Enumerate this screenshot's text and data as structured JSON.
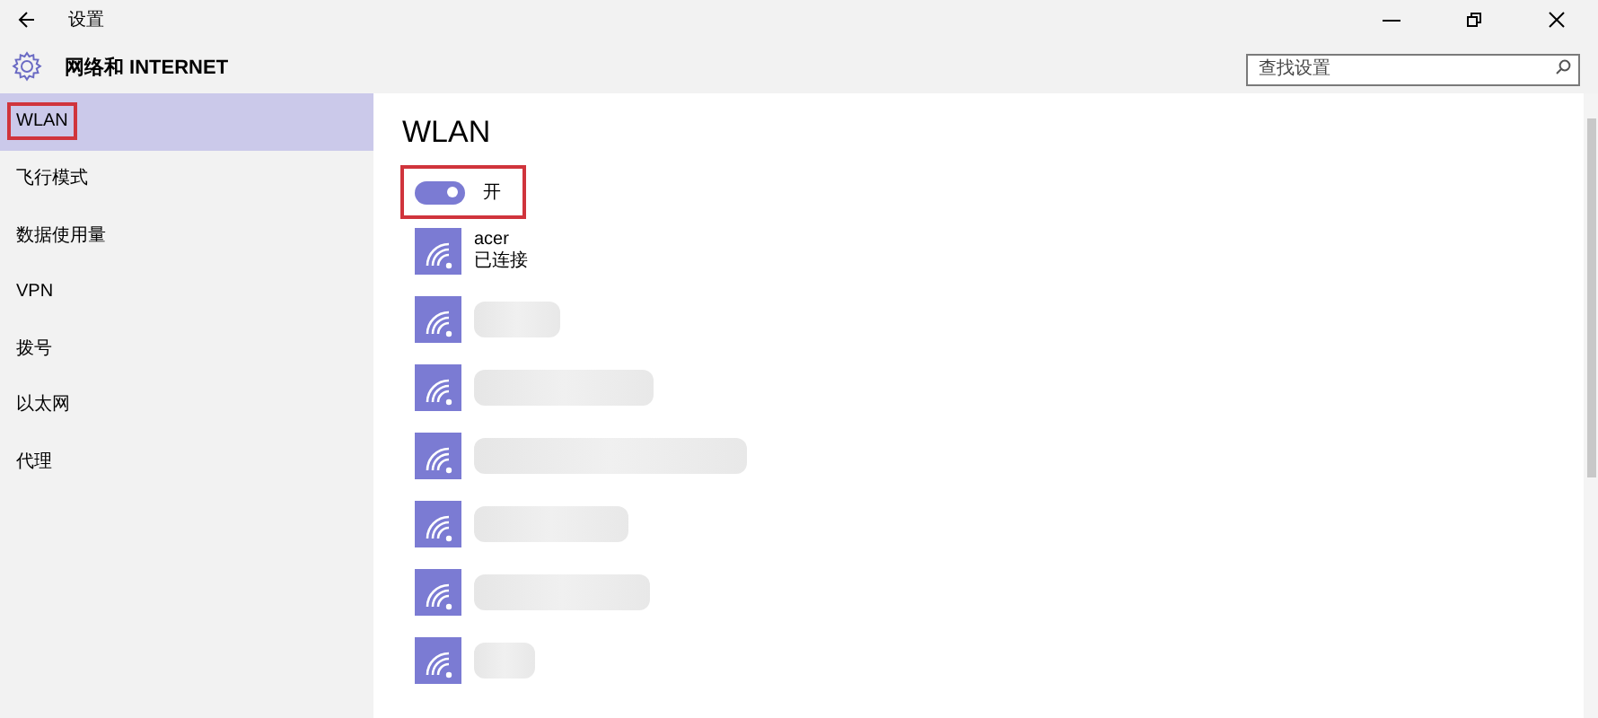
{
  "window": {
    "title": "设置"
  },
  "header": {
    "title": "网络和 INTERNET",
    "search": {
      "placeholder": "查找设置"
    }
  },
  "sidebar": {
    "items": [
      {
        "label": "WLAN",
        "selected": true,
        "highlighted": true
      },
      {
        "label": "飞行模式",
        "selected": false,
        "highlighted": false
      },
      {
        "label": "数据使用量",
        "selected": false,
        "highlighted": false
      },
      {
        "label": "VPN",
        "selected": false,
        "highlighted": false
      },
      {
        "label": "拨号",
        "selected": false,
        "highlighted": false
      },
      {
        "label": "以太网",
        "selected": false,
        "highlighted": false
      },
      {
        "label": "代理",
        "selected": false,
        "highlighted": false
      }
    ]
  },
  "main": {
    "title": "WLAN",
    "toggle": {
      "label": "开",
      "on": true,
      "highlighted": true
    },
    "networks": [
      {
        "kind": "named",
        "name": "acer",
        "status": "已连接"
      },
      {
        "kind": "blurred"
      },
      {
        "kind": "blurred"
      },
      {
        "kind": "blurred"
      },
      {
        "kind": "blurred"
      },
      {
        "kind": "blurred"
      },
      {
        "kind": "blurred"
      }
    ]
  }
}
